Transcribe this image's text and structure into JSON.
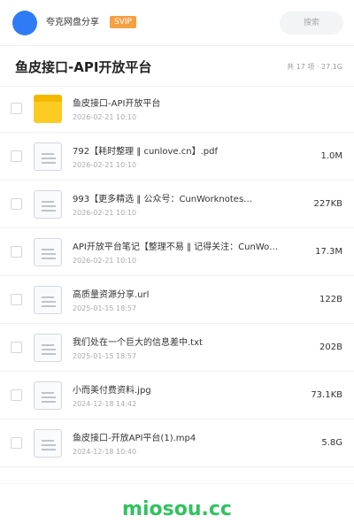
{
  "header": {
    "owner_name": "夸克网盘分享",
    "badge": "SVIP",
    "search": {
      "placeholder": "搜索"
    }
  },
  "share": {
    "title": "鱼皮接口-API开放平台",
    "summary": "共 17 项 · 27.1G"
  },
  "files": [
    {
      "type": "folder",
      "name": "鱼皮接口-API开放平台",
      "date": "2026-02-21 10:10",
      "size": ""
    },
    {
      "type": "file",
      "name": "792【耗时整理 ‖ cunlove.cn】.pdf",
      "date": "2026-02-21 10:10",
      "size": "1.0M"
    },
    {
      "type": "file",
      "name": "993【更多精选 ‖ 公众号：CunWorknotes…",
      "date": "2026-02-21 10:10",
      "size": "227KB"
    },
    {
      "type": "file",
      "name": "API开放平台笔记【整理不易 ‖ 记得关注：CunWo…",
      "date": "2026-02-21 10:10",
      "size": "17.3M"
    },
    {
      "type": "file",
      "name": "高质量资源分享.url",
      "date": "2025-01-15 18:57",
      "size": "122B"
    },
    {
      "type": "file",
      "name": "我们处在一个巨大的信息差中.txt",
      "date": "2025-01-15 18:57",
      "size": "202B"
    },
    {
      "type": "file",
      "name": "小而美付费资料.jpg",
      "date": "2024-12-18 14:42",
      "size": "73.1KB"
    },
    {
      "type": "file",
      "name": "鱼皮接口-开放API平台(1).mp4",
      "date": "2024-12-18 10:40",
      "size": "5.8G"
    }
  ],
  "watermark": "miosou.cc",
  "colors": {
    "avatar": "#2f7bf6",
    "badge": "#f5a043",
    "folder": "#fccc22",
    "watermark": "#2fc35f"
  }
}
